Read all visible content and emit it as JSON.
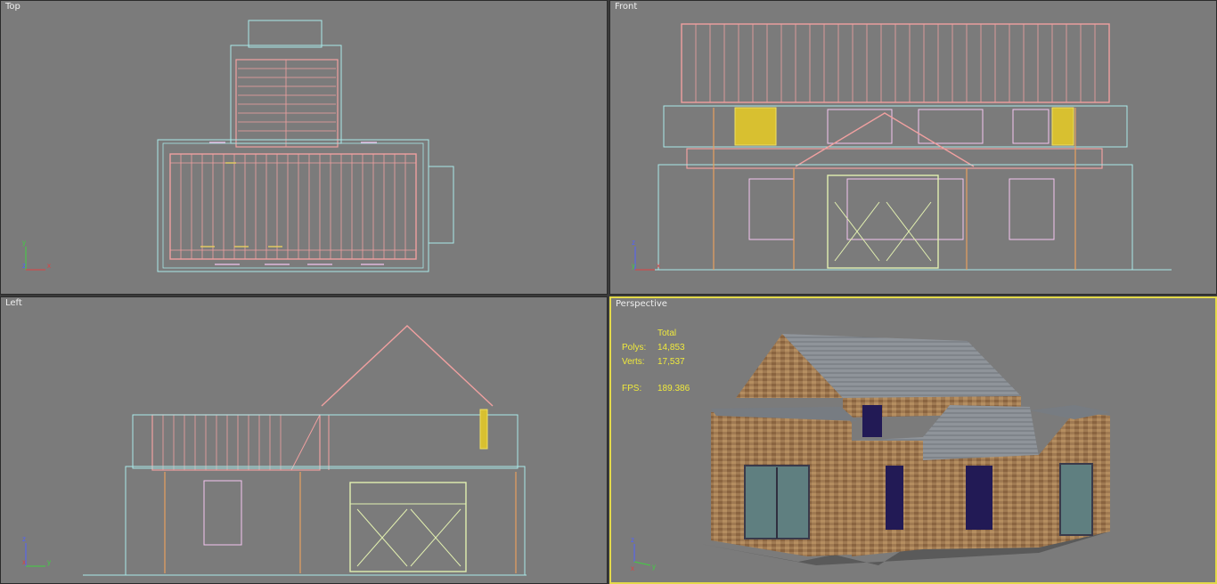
{
  "viewports": {
    "top": {
      "label": "Top"
    },
    "front": {
      "label": "Front"
    },
    "left": {
      "label": "Left"
    },
    "perspective": {
      "label": "Perspective"
    }
  },
  "stats": {
    "header": "Total",
    "polys_label": "Polys:",
    "polys_value": "14,853",
    "verts_label": "Verts:",
    "verts_value": "17,537",
    "fps_label": "FPS:",
    "fps_value": "189.386"
  },
  "axes": {
    "top": [
      "y",
      "z",
      "x"
    ],
    "front": [
      "z",
      "y",
      "x"
    ],
    "left": [
      "z",
      "x",
      "y"
    ],
    "perspective": [
      "z",
      "x",
      "y"
    ]
  },
  "colors": {
    "viewport_bg": "#7b7b7b",
    "active_border": "#e3d94a",
    "wire_roof": "#f0a0a0",
    "wire_wall": "#a8e8e8",
    "wire_window": "#f4c4f0",
    "wire_frame": "#e2f0b0",
    "wire_post": "#e8a060",
    "stats_text": "#f0ea3c"
  }
}
